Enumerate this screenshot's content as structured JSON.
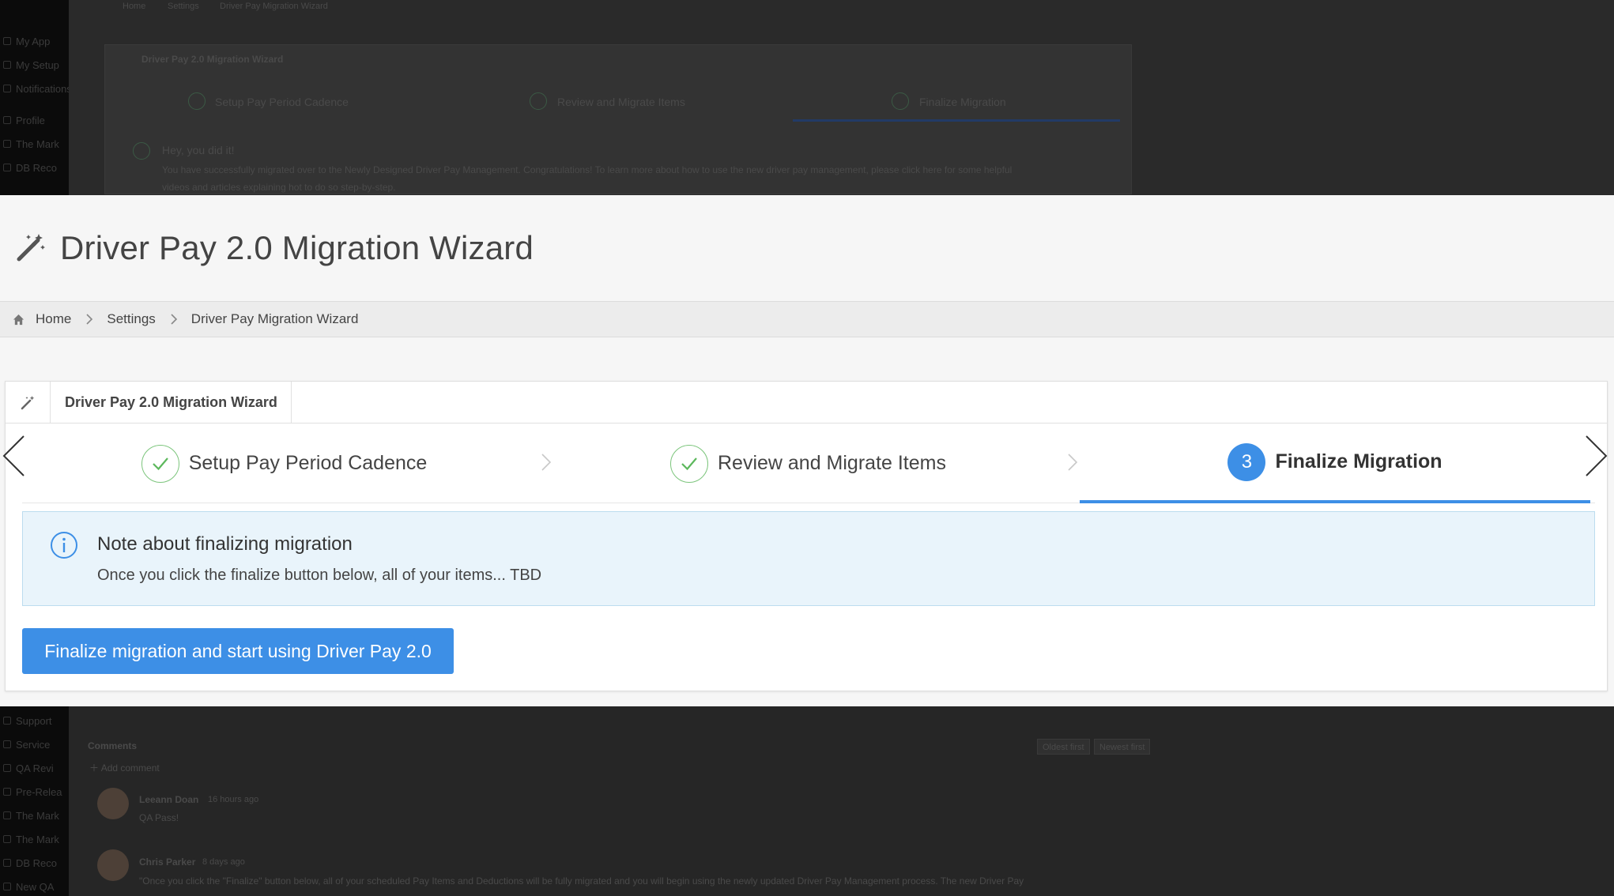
{
  "background": {
    "sidebar_items": [
      "My App",
      "My Setup",
      "Notifications",
      "Profile",
      "The Mark",
      "DB Reco",
      "Support",
      "Service",
      "QA Revi",
      "Pre-Relea",
      "The Mark",
      "The Mark",
      "DB Reco",
      "New QA"
    ],
    "breadcrumb": [
      "Home",
      "Settings",
      "Driver Pay Migration Wizard"
    ],
    "card_title": "Driver Pay 2.0 Migration Wizard",
    "steps": [
      "Setup Pay Period Cadence",
      "Review and Migrate Items",
      "Finalize Migration"
    ],
    "success_title": "Hey, you did it!",
    "success_body_1": "You have successfully migrated over to the Newly Designed Driver Pay Management. Congratulations! To learn more about how to use the new driver pay management, please click here for some helpful",
    "success_body_2": "videos and articles explaining hot to do so step-by-step.",
    "comments_title": "Comments",
    "add_comment": "Add comment",
    "sort_oldest": "Oldest first",
    "sort_newest": "Newest first",
    "comments": [
      {
        "author": "Leeann Doan",
        "time": "16 hours ago",
        "text": "QA Pass!"
      },
      {
        "author": "Chris Parker",
        "time": "8 days ago",
        "text": "\"Once you click the \"Finalize\" button below, all of your scheduled Pay Items and Deductions will be fully migrated and you will begin using the newly updated Driver Pay Management process. The new Driver Pay"
      }
    ]
  },
  "header": {
    "title": "Driver Pay 2.0 Migration Wizard",
    "icon": "magic-wand-icon"
  },
  "breadcrumb": {
    "home": "Home",
    "settings": "Settings",
    "current": "Driver Pay Migration Wizard"
  },
  "card": {
    "tab_title": "Driver Pay 2.0 Migration Wizard",
    "steps": [
      {
        "label": "Setup Pay Period Cadence",
        "status": "complete"
      },
      {
        "label": "Review and Migrate Items",
        "status": "complete"
      },
      {
        "number": "3",
        "label": "Finalize Migration",
        "status": "active"
      }
    ],
    "note": {
      "title": "Note about finalizing migration",
      "body": "Once you click the finalize button below, all of your items... TBD"
    },
    "finalize_button": "Finalize migration and start using Driver Pay 2.0"
  },
  "colors": {
    "accent": "#3d8fe6",
    "success": "#7cc57c",
    "info_bg": "#e9f4fb",
    "info_border": "#bcdcef"
  }
}
